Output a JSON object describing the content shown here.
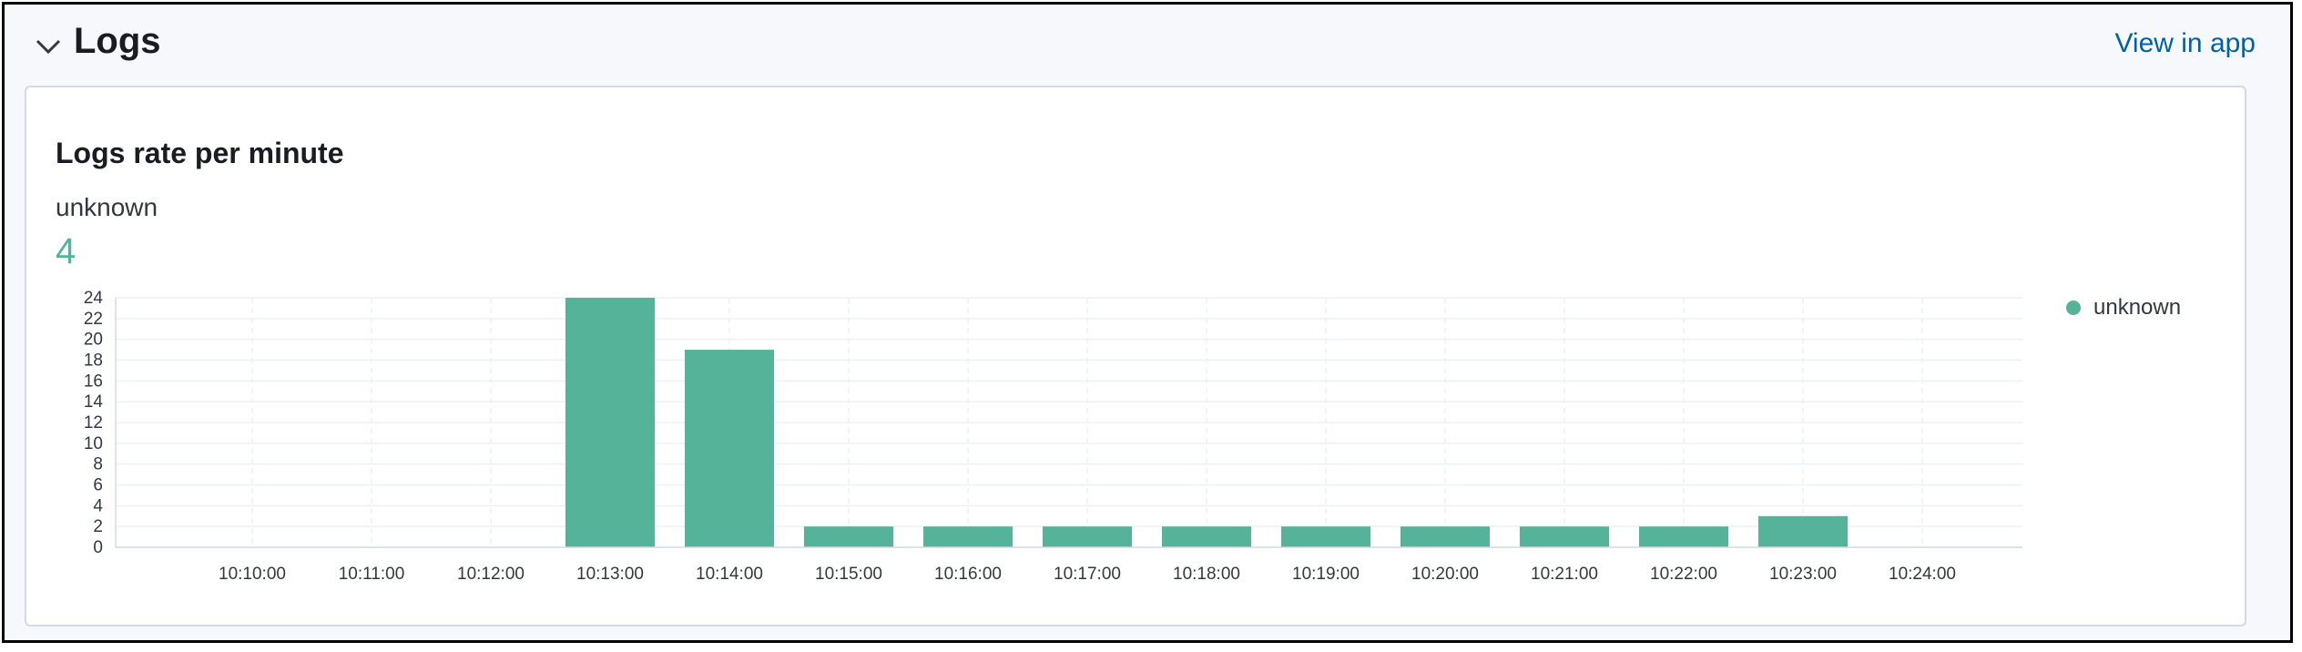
{
  "section": {
    "title": "Logs",
    "link_label": "View in app"
  },
  "card": {
    "title": "Logs rate per minute",
    "metric_label": "unknown",
    "metric_value": "4"
  },
  "colors": {
    "series": "#54b399",
    "grid": "#eef0f4",
    "axis": "#343741"
  },
  "chart_data": {
    "type": "bar",
    "categories": [
      "10:10:00",
      "10:11:00",
      "10:12:00",
      "10:13:00",
      "10:14:00",
      "10:15:00",
      "10:16:00",
      "10:17:00",
      "10:18:00",
      "10:19:00",
      "10:20:00",
      "10:21:00",
      "10:22:00",
      "10:23:00",
      "10:24:00"
    ],
    "series": [
      {
        "name": "unknown",
        "values": [
          0,
          0,
          0,
          24,
          19,
          2,
          2,
          2,
          2,
          2,
          2,
          2,
          2,
          3,
          0
        ]
      }
    ],
    "yticks": [
      0,
      2,
      4,
      6,
      8,
      10,
      12,
      14,
      16,
      18,
      20,
      22,
      24
    ],
    "ylim": [
      0,
      24
    ],
    "grid": true,
    "legend_position": "right"
  }
}
